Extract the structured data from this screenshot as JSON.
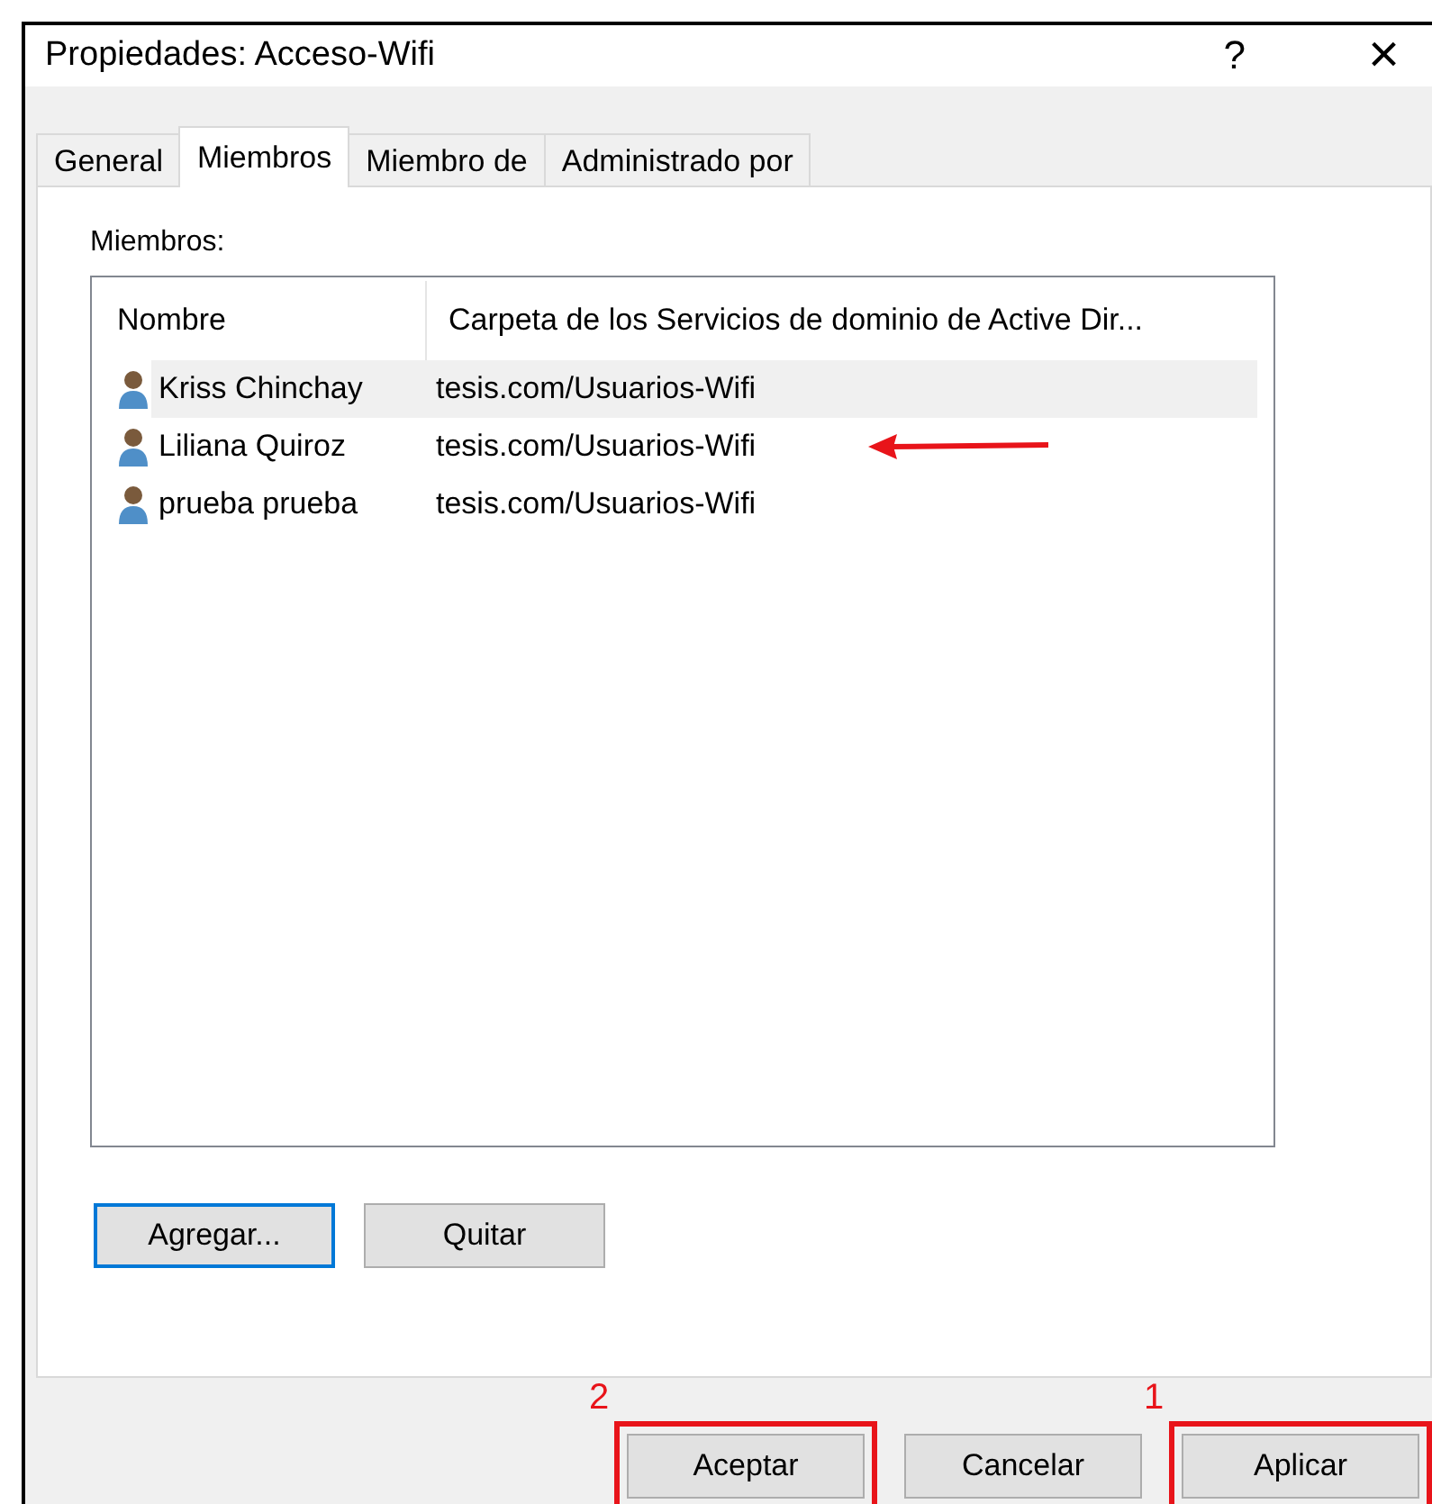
{
  "window": {
    "title": "Propiedades: Acceso-Wifi",
    "help": "?",
    "close": "×"
  },
  "tabs": [
    {
      "label": "General",
      "selected": false
    },
    {
      "label": "Miembros",
      "selected": true
    },
    {
      "label": "Miembro de",
      "selected": false
    },
    {
      "label": "Administrado por",
      "selected": false
    }
  ],
  "members_label": "Miembros:",
  "table": {
    "columns": [
      "Nombre",
      "Carpeta de los Servicios de dominio de Active Dir..."
    ],
    "rows": [
      {
        "name": "Kriss Chinchay",
        "folder": "tesis.com/Usuarios-Wifi",
        "selected": true,
        "arrow": false
      },
      {
        "name": "Liliana Quiroz",
        "folder": "tesis.com/Usuarios-Wifi",
        "selected": false,
        "arrow": true
      },
      {
        "name": "prueba prueba",
        "folder": "tesis.com/Usuarios-Wifi",
        "selected": false,
        "arrow": false
      }
    ]
  },
  "list_buttons": [
    {
      "label": "Agregar...",
      "focused": true
    },
    {
      "label": "Quitar",
      "focused": false
    }
  ],
  "dialog_buttons": [
    {
      "label": "Aceptar",
      "highlighted": true,
      "step": "2"
    },
    {
      "label": "Cancelar",
      "highlighted": false
    },
    {
      "label": "Aplicar",
      "highlighted": true,
      "step": "1"
    }
  ]
}
